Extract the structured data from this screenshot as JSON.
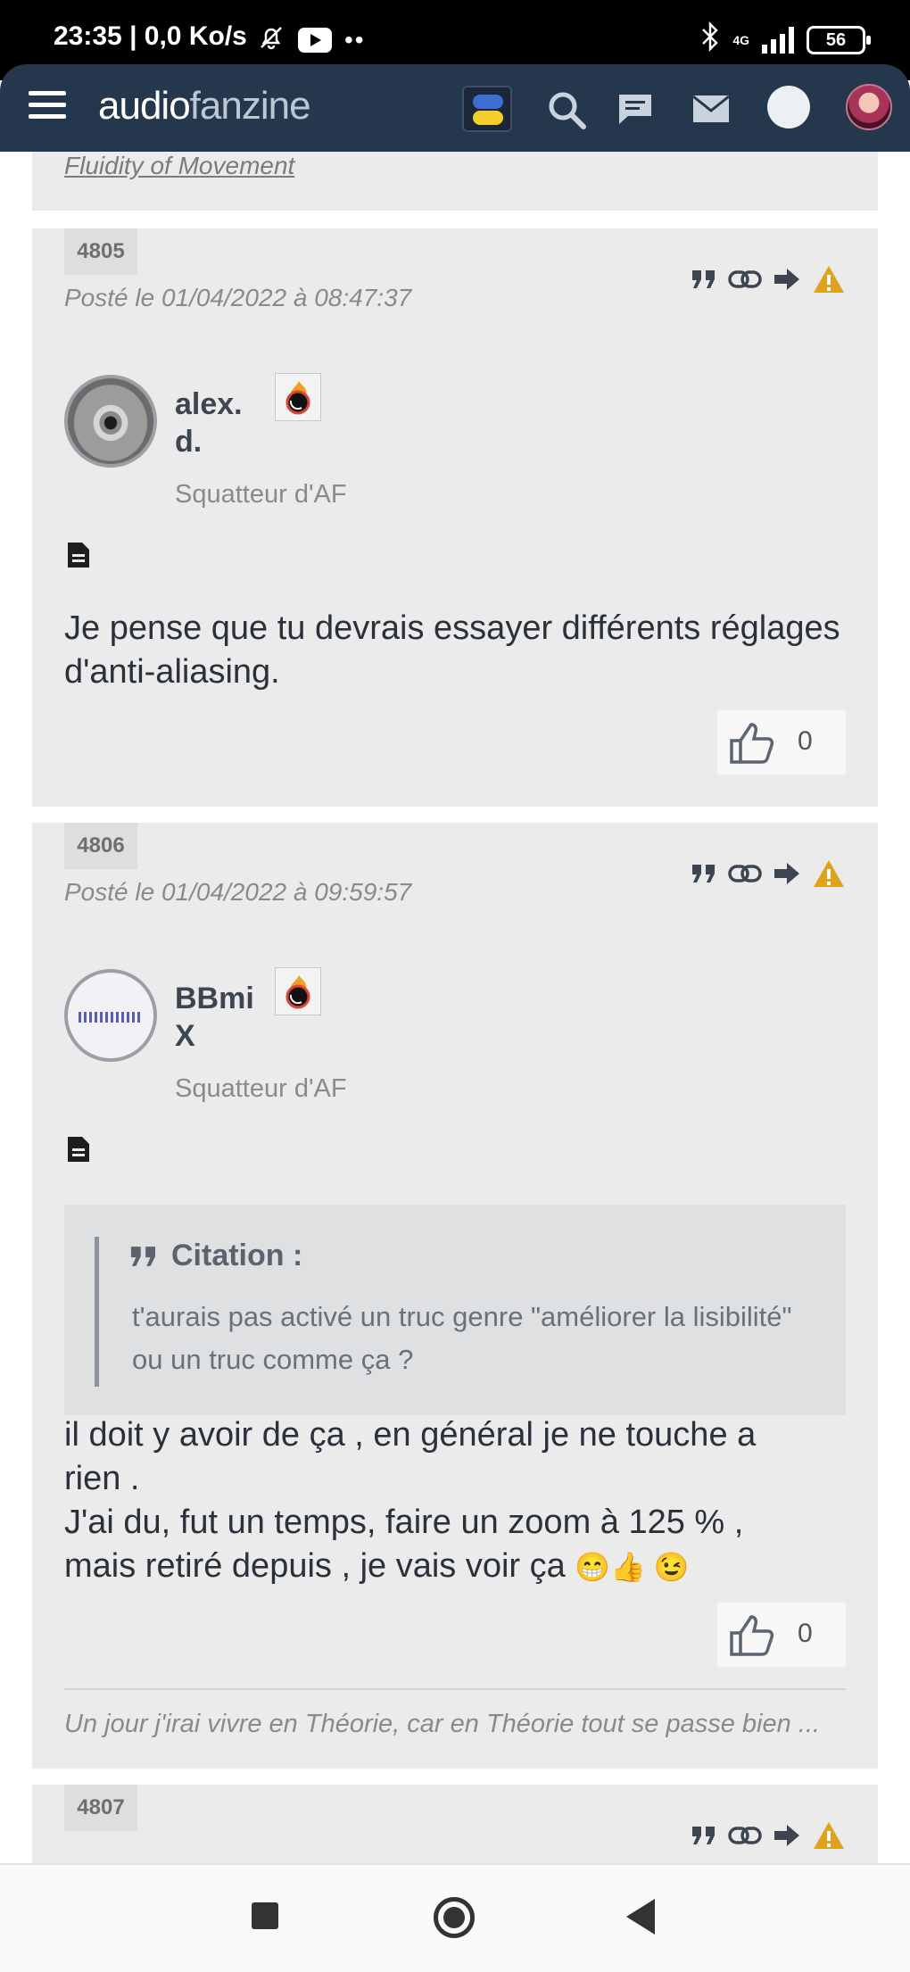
{
  "status_bar": {
    "time_speed": "23:35 | 0,0 Ko/s",
    "network": "4G",
    "battery": "56"
  },
  "header": {
    "logo_part1": "audio",
    "logo_part2": "fanzine"
  },
  "previous_post": {
    "signature": "Fluidity of Movement"
  },
  "posts": [
    {
      "number": "4805",
      "date": "Posté le 01/04/2022 à 08:47:37",
      "author_line1": "alex.",
      "author_line2": "d.",
      "rank": "Squatteur d'AF",
      "body": "Je pense que tu devrais essayer différents réglages d'anti-aliasing.",
      "likes": "0"
    },
    {
      "number": "4806",
      "date": "Posté le 01/04/2022 à 09:59:57",
      "author_line1": "BBmi",
      "author_line2": "X",
      "rank": "Squatteur d'AF",
      "quote_title": "Citation :",
      "quote_text": "t'aurais pas activé un truc genre \"améliorer la lisibilité\" ou un truc comme ça ?",
      "body_line1": "il doit y avoir de ça , en général je ne touche a",
      "body_line2": "rien .",
      "body_line3": "J'ai du, fut un temps, faire un zoom à 125 % ,",
      "body_line4": "mais retiré depuis , je vais voir ça",
      "emojis": "😁👍 😉",
      "likes": "0",
      "signature": "Un jour j'irai vivre en Théorie, car en Théorie tout se passe bien ..."
    },
    {
      "number": "4807"
    }
  ],
  "colors": {
    "header_bg": "#25374d",
    "post_bg": "#ebebeb",
    "warning": "#e0a11b"
  }
}
